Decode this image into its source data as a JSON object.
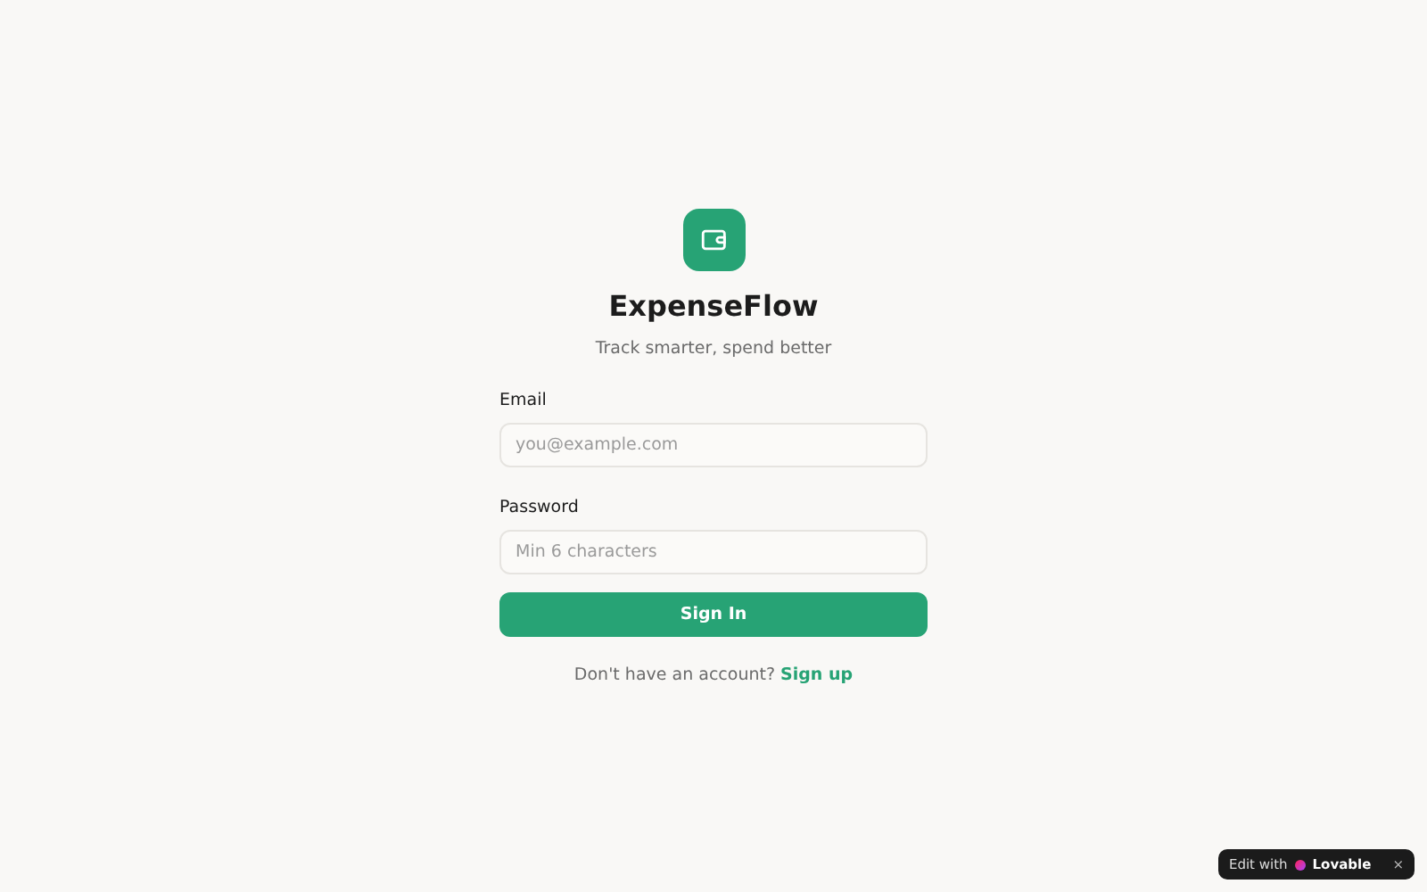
{
  "brand": {
    "name": "ExpenseFlow",
    "tagline": "Track smarter, spend better"
  },
  "fields": [
    {
      "label": "Email",
      "placeholder": "you@example.com"
    },
    {
      "label": "Password",
      "placeholder": "Min 6 characters"
    }
  ],
  "submit": "Sign In",
  "footer": {
    "text": "Don't have an account?",
    "link": "Sign up"
  },
  "badge": {
    "text": "Edit with",
    "brand": "Lovable",
    "close": "×"
  }
}
